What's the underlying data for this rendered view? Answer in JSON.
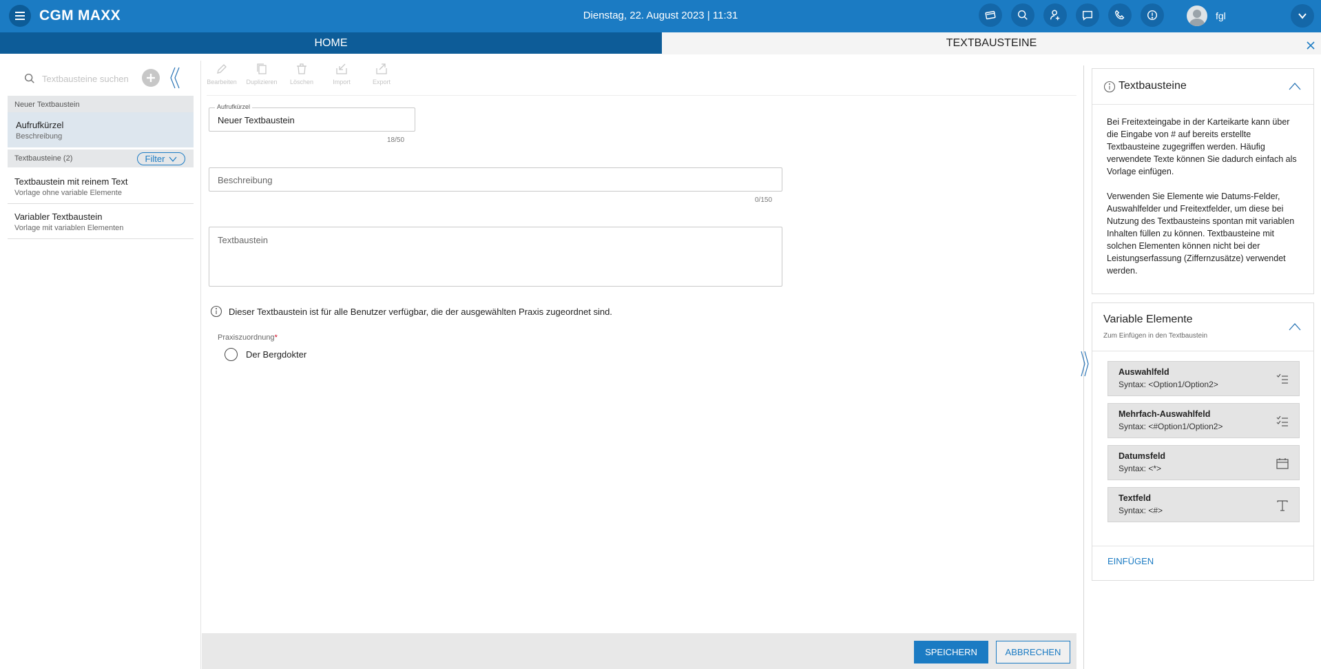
{
  "header": {
    "brand": "CGM MAXX",
    "datetime": "Dienstag, 22. August 2023 | 11:31",
    "username": "fgl"
  },
  "tabs": {
    "home": "HOME",
    "active": "TEXTBAUSTEINE"
  },
  "sidebar": {
    "search_placeholder": "Textbausteine suchen",
    "new_group_label": "Neuer Textbaustein",
    "selected_item": {
      "title": "Aufrufkürzel",
      "subtitle": "Beschreibung"
    },
    "list_group_label": "Textbausteine (2)",
    "filter_label": "Filter",
    "items": [
      {
        "title": "Textbaustein mit reinem Text",
        "subtitle": "Vorlage ohne variable Elemente"
      },
      {
        "title": "Variabler Textbaustein",
        "subtitle": "Vorlage mit variablen Elementen"
      }
    ]
  },
  "toolbar": {
    "edit": "Bearbeiten",
    "duplicate": "Duplizieren",
    "delete": "Löschen",
    "import": "Import",
    "export": "Export"
  },
  "form": {
    "shortcut_label": "Aufrufkürzel",
    "shortcut_value": "Neuer Textbaustein",
    "shortcut_counter": "18/50",
    "description_placeholder": "Beschreibung",
    "description_counter": "0/150",
    "text_placeholder": "Textbaustein",
    "info_text": "Dieser Textbaustein ist für alle Benutzer verfügbar, die der ausgewählten Praxis zugeordnet sind.",
    "practice_label": "Praxiszuordnung",
    "practice_required_mark": "*",
    "practice_option": "Der Bergdokter"
  },
  "footer": {
    "save": "SPEICHERN",
    "cancel": "ABBRECHEN"
  },
  "info_card": {
    "title": "Textbausteine",
    "paragraph1": "Bei Freitexteingabe in der Karteikarte kann über die Eingabe von # auf bereits erstellte Textbausteine zugegriffen werden. Häufig verwendete Texte können Sie dadurch einfach als Vorlage einfügen.",
    "paragraph2": "Verwenden Sie Elemente wie Datums-Felder, Auswahlfelder und Freitextfelder, um diese bei Nutzung des Textbausteins spontan mit variablen Inhalten füllen zu können. Textbausteine mit solchen Elementen können nicht bei der Leistungserfassung (Ziffernzusätze) verwendet werden."
  },
  "variables_card": {
    "title": "Variable Elemente",
    "subtitle": "Zum Einfügen in den Textbaustein",
    "items": [
      {
        "title": "Auswahlfeld",
        "syntax": "Syntax: <Option1/Option2>",
        "icon": "single-select-list-icon"
      },
      {
        "title": "Mehrfach-Auswahlfeld",
        "syntax": "Syntax: <#Option1/Option2>",
        "icon": "multi-select-list-icon"
      },
      {
        "title": "Datumsfeld",
        "syntax": "Syntax: <*>",
        "icon": "calendar-icon"
      },
      {
        "title": "Textfeld",
        "syntax": "Syntax: <#>",
        "icon": "text-icon"
      }
    ],
    "insert_label": "EINFÜGEN"
  },
  "colors": {
    "primary": "#1b7bc3",
    "primary_dark": "#0d5c98",
    "selected_bg": "#dde6ee",
    "required": "#d0021b"
  }
}
